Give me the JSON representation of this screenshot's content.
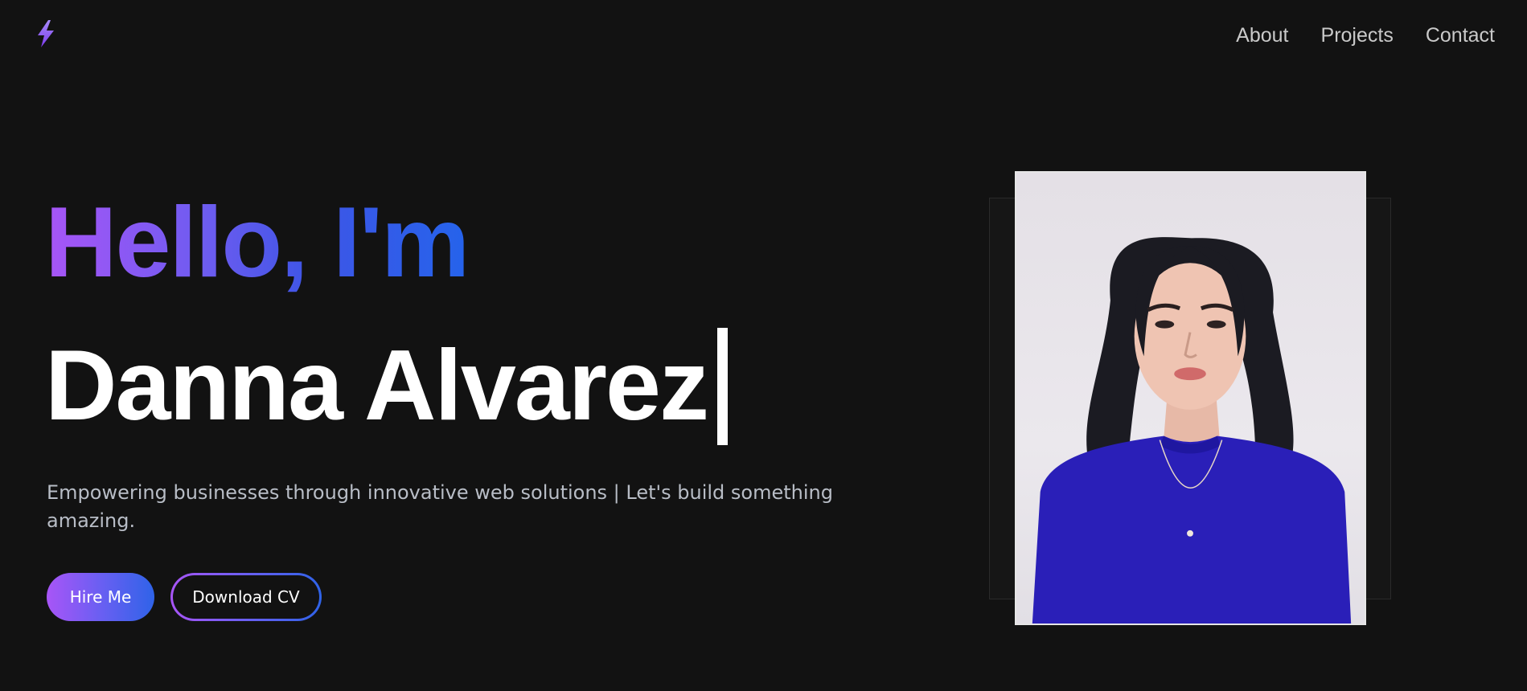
{
  "header": {
    "logo_icon": "lightning-bolt-icon",
    "nav": [
      {
        "label": "About"
      },
      {
        "label": "Projects"
      },
      {
        "label": "Contact"
      }
    ]
  },
  "hero": {
    "greeting": "Hello, I'm",
    "name": "Danna Alvarez",
    "tagline": "Empowering businesses through innovative web solutions | Let's build something amazing.",
    "buttons": {
      "primary": "Hire Me",
      "secondary": "Download CV"
    }
  },
  "colors": {
    "background": "#121212",
    "accent_purple": "#a855f7",
    "accent_blue": "#2563eb",
    "nav_text": "#c9c9c9",
    "tagline_text": "#b8bdc6"
  }
}
